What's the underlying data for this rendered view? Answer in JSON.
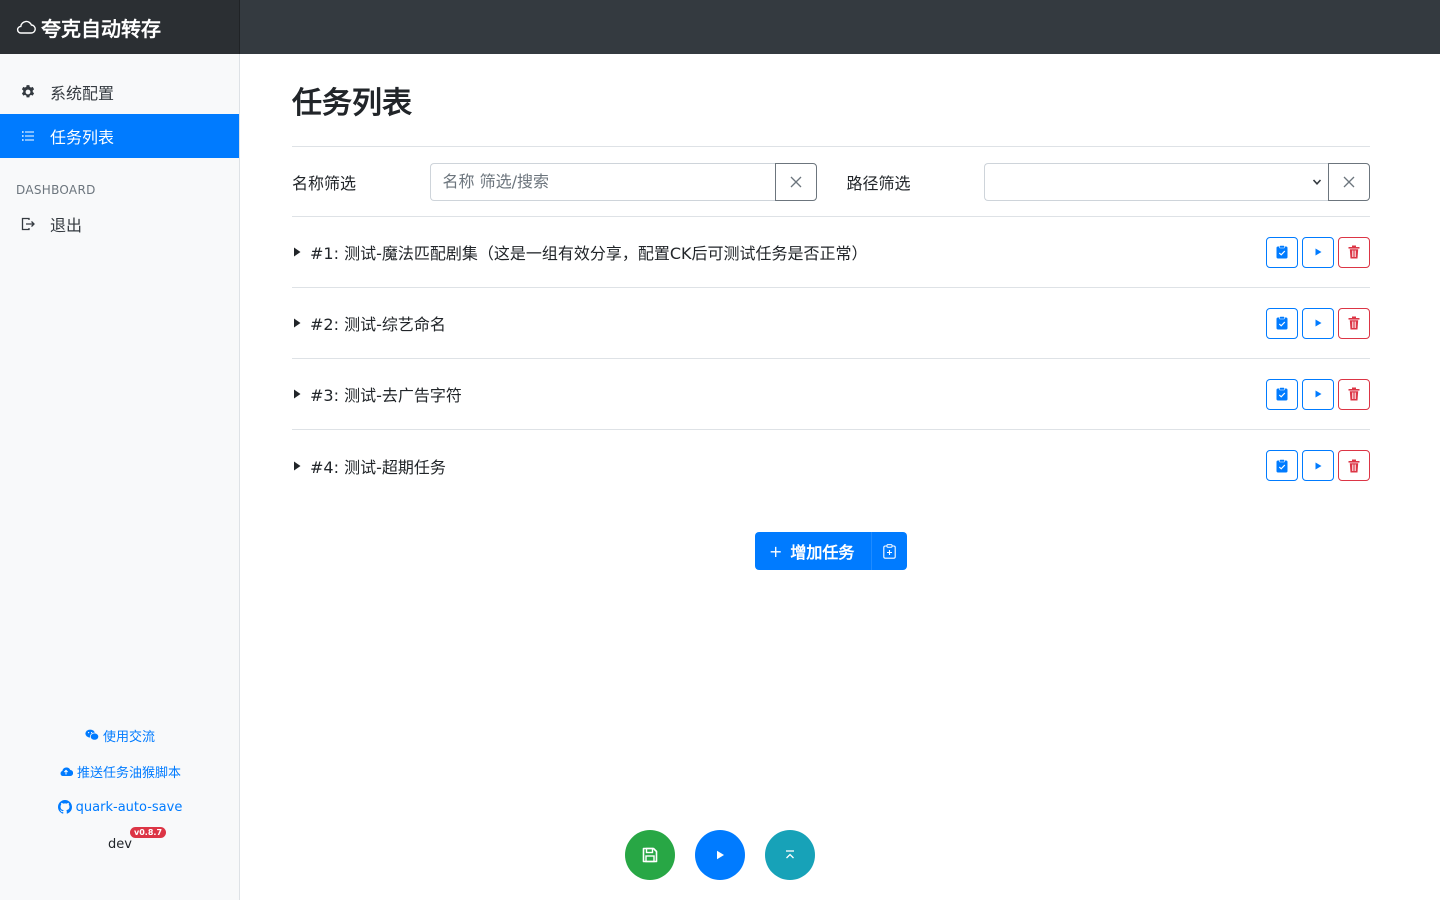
{
  "app": {
    "title": "夸克自动转存"
  },
  "sidebar": {
    "items": [
      {
        "label": "系统配置"
      },
      {
        "label": "任务列表"
      }
    ],
    "heading": "DASHBOARD",
    "logout_label": "退出",
    "links": [
      {
        "label": "使用交流"
      },
      {
        "label": "推送任务油猴脚本"
      },
      {
        "label": "quark-auto-save"
      }
    ],
    "version_text": "dev",
    "version_badge": "v0.8.7"
  },
  "main": {
    "title": "任务列表",
    "filters": {
      "name_label": "名称筛选",
      "name_placeholder": "名称 筛选/搜索",
      "path_label": "路径筛选",
      "path_value": ""
    },
    "tasks": [
      {
        "name": "#1: 测试-魔法匹配剧集（这是一组有效分享，配置CK后可测试任务是否正常）"
      },
      {
        "name": "#2: 测试-综艺命名"
      },
      {
        "name": "#3: 测试-去广告字符"
      },
      {
        "name": "#4: 测试-超期任务"
      }
    ],
    "add_task_label": "增加任务"
  },
  "colors": {
    "primary": "#007bff",
    "success": "#28a745",
    "info": "#17a2b8",
    "danger": "#dc3545",
    "topbar": "#343a40"
  }
}
